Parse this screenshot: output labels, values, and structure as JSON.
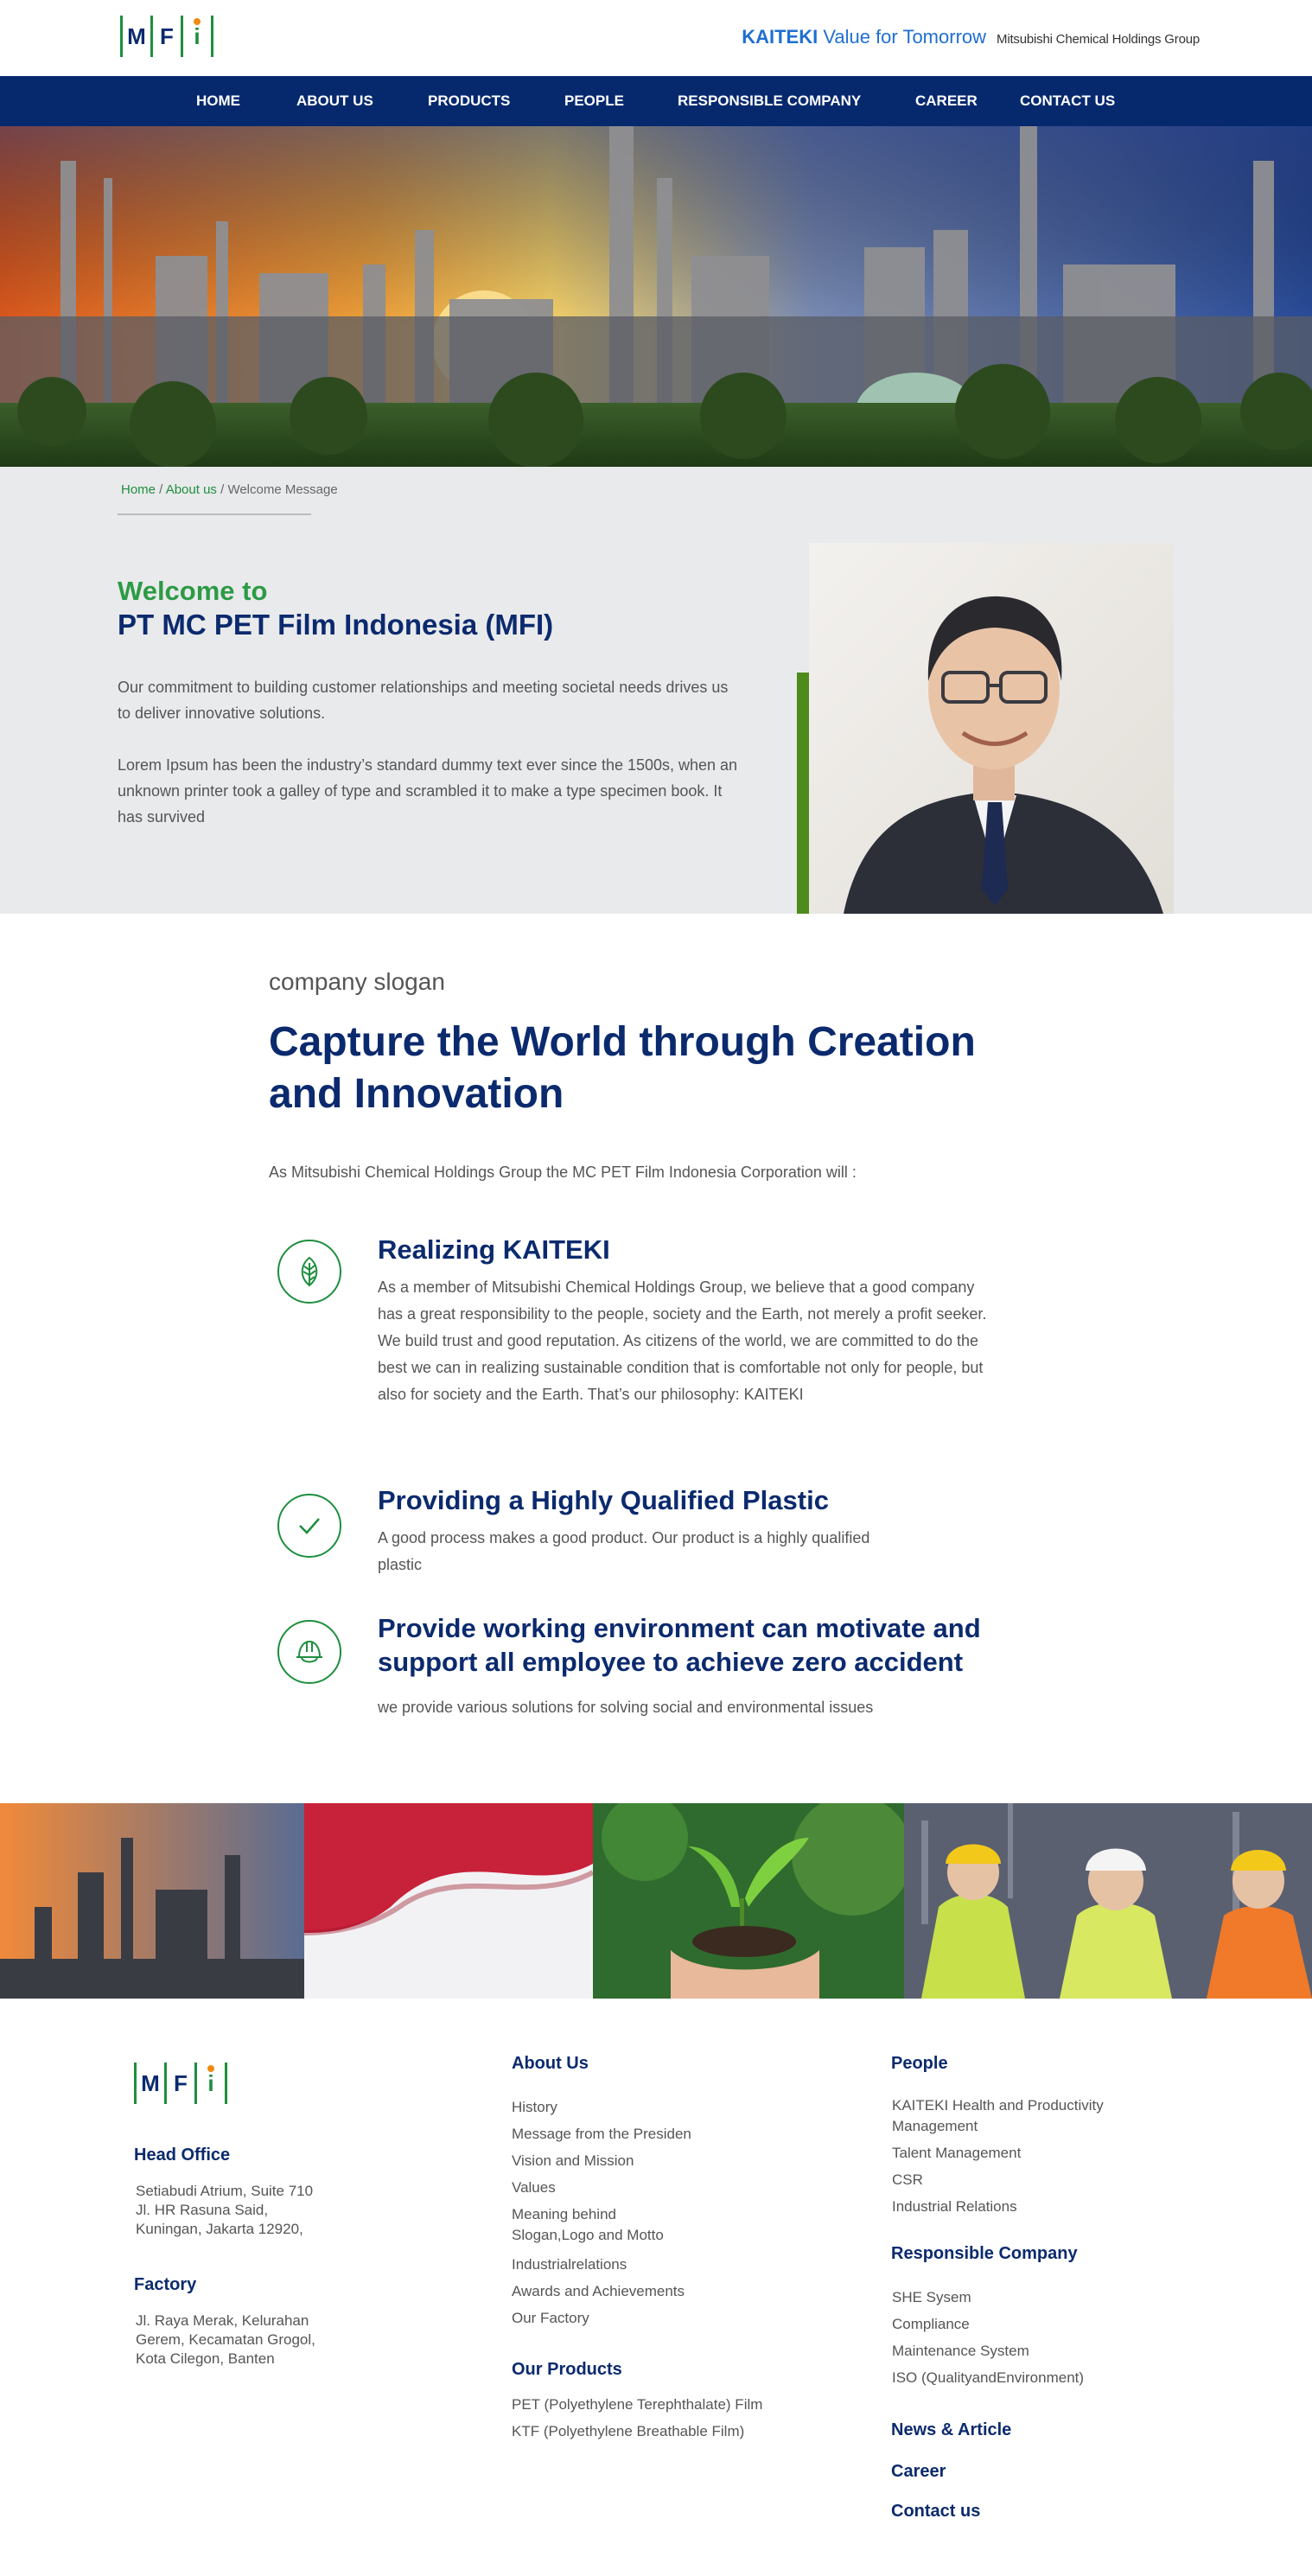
{
  "header": {
    "logo_letters": [
      "M",
      "F",
      "i"
    ],
    "kaiteki_bold": "KAITEKI",
    "kaiteki_rest": " Value for Tomorrow",
    "group_name": "Mitsubishi Chemical Holdings Group"
  },
  "nav": {
    "items": [
      {
        "label": "HOME"
      },
      {
        "label": "ABOUT US"
      },
      {
        "label": "PRODUCTS"
      },
      {
        "label": "PEOPLE"
      },
      {
        "label": "RESPONSIBLE COMPANY"
      },
      {
        "label": "CAREER"
      },
      {
        "label": "CONTACT US"
      }
    ]
  },
  "breadcrumb": {
    "home": "Home",
    "sep": " / ",
    "about": "About us",
    "current": "Welcome Message"
  },
  "welcome": {
    "kicker": "Welcome to",
    "title": "PT MC PET Film Indonesia (MFI)",
    "p1": "Our commitment to building customer relationships and meeting societal needs drives us to deliver innovative solutions.",
    "p2": "Lorem Ipsum has been the industry’s standard dummy text ever since the 1500s, when an unknown printer took a galley of type and scrambled it to make a type specimen book. It has survived"
  },
  "slogan": {
    "label": "company slogan",
    "title": "Capture the World through Creation and Innovation",
    "intro": "As Mitsubishi Chemical Holdings Group the MC PET Film Indonesia Corporation will :"
  },
  "values": [
    {
      "icon": "leaf-icon",
      "title": "Realizing KAITEKI",
      "text": "As a member of Mitsubishi Chemical Holdings Group, we believe that a good company has a great responsibility to the people, society and the Earth, not merely a profit seeker. We build trust and good reputation. As citizens of the world, we are committed to do the best we can in realizing sustainable condition that is comfortable not only for people, but also for society and the Earth. That’s our philosophy: KAITEKI"
    },
    {
      "icon": "checkmark-icon",
      "title": "Providing a Highly Qualified Plastic",
      "text": "A good process makes a good product. Our product is a highly qualified plastic"
    },
    {
      "icon": "safety-helmet-icon",
      "title": "Provide working environment can motivate and support all employee to achieve zero accident",
      "text": "we provide various solutions for solving social and environmental issues"
    }
  ],
  "footer": {
    "head_office": {
      "title": "Head Office",
      "lines": [
        "Setiabudi Atrium, Suite 710",
        "Jl. HR Rasuna Said,",
        "Kuningan, Jakarta 12920,"
      ]
    },
    "factory": {
      "title": "Factory",
      "lines": [
        "Jl. Raya Merak, Kelurahan",
        "Gerem, Kecamatan Grogol,",
        "Kota Cilegon, Banten"
      ]
    },
    "about": {
      "title": "About Us",
      "items": [
        "History",
        "Message from the Presiden",
        "Vision and Mission",
        "Values",
        "Meaning behind",
        "Slogan,Logo and Motto",
        "Industrialrelations",
        "Awards and Achievements",
        "Our Factory"
      ]
    },
    "products": {
      "title": "Our Products",
      "items": [
        "PET (Polyethylene Terephthalate) Film",
        "KTF (Polyethylene Breathable Film)"
      ]
    },
    "people": {
      "title": "People",
      "items": [
        "KAITEKI Health and Productivity",
        "Management",
        "Talent Management",
        "CSR",
        "Industrial Relations"
      ]
    },
    "responsible": {
      "title": "Responsible Company",
      "items": [
        "SHE Sysem",
        "Compliance",
        "Maintenance System",
        "ISO (QualityandEnvironment)"
      ]
    },
    "news": "News & Article",
    "career": "Career",
    "contact": "Contact us"
  },
  "colors": {
    "navy": "#06296e",
    "green": "#1e8e3e",
    "accent_bar": "#4f8a1c",
    "light_bg": "#e9eaec"
  }
}
